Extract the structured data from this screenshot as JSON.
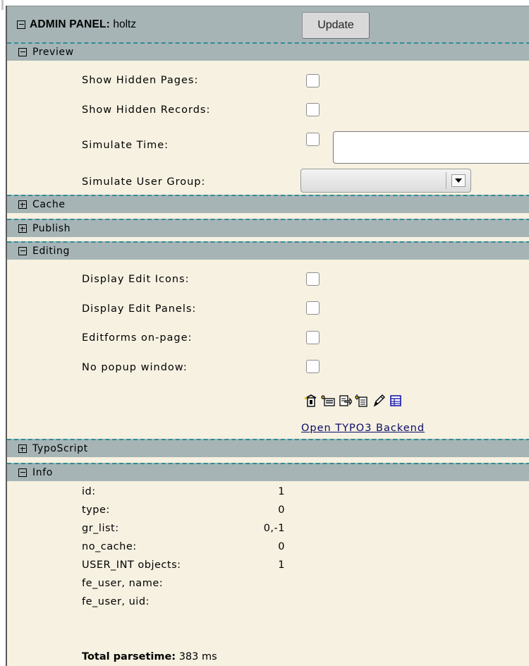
{
  "header": {
    "title_bold": "ADMIN PANEL:",
    "user": "holtz",
    "update_label": "Update"
  },
  "sections": {
    "preview": {
      "label": "Preview",
      "show_hidden_pages": "Show Hidden Pages:",
      "show_hidden_records": "Show Hidden Records:",
      "simulate_time": "Simulate Time:",
      "simulate_user_group": "Simulate User Group:"
    },
    "cache": {
      "label": "Cache"
    },
    "publish": {
      "label": "Publish"
    },
    "editing": {
      "label": "Editing",
      "display_edit_icons": "Display Edit Icons:",
      "display_edit_panels": "Display Edit Panels:",
      "editforms_on_page": "Editforms on-page:",
      "no_popup_window": "No popup window:",
      "backend_link": "Open TYPO3 Backend"
    },
    "typoscript": {
      "label": "TypoScript"
    },
    "info": {
      "label": "Info",
      "rows": [
        {
          "key": "id:",
          "value": "1"
        },
        {
          "key": "type:",
          "value": "0"
        },
        {
          "key": "gr_list:",
          "value": "0,-1"
        },
        {
          "key": "no_cache:",
          "value": "0"
        },
        {
          "key": "USER_INT objects:",
          "value": "1"
        },
        {
          "key": "fe_user, name:",
          "value": ""
        },
        {
          "key": "fe_user, uid:",
          "value": ""
        }
      ],
      "parsetime_label": "Total parsetime:",
      "parsetime_value": "383 ms"
    }
  },
  "icons": [
    "move-page-icon",
    "new-record-icon",
    "edit-page-icon",
    "new-page-icon",
    "edit-icon",
    "list-module-icon"
  ],
  "colors": {
    "section_bg": "#a6b4b6",
    "panel_bg": "#f6f1e1",
    "separator": "#2f8c96",
    "link": "#0a0a66"
  }
}
